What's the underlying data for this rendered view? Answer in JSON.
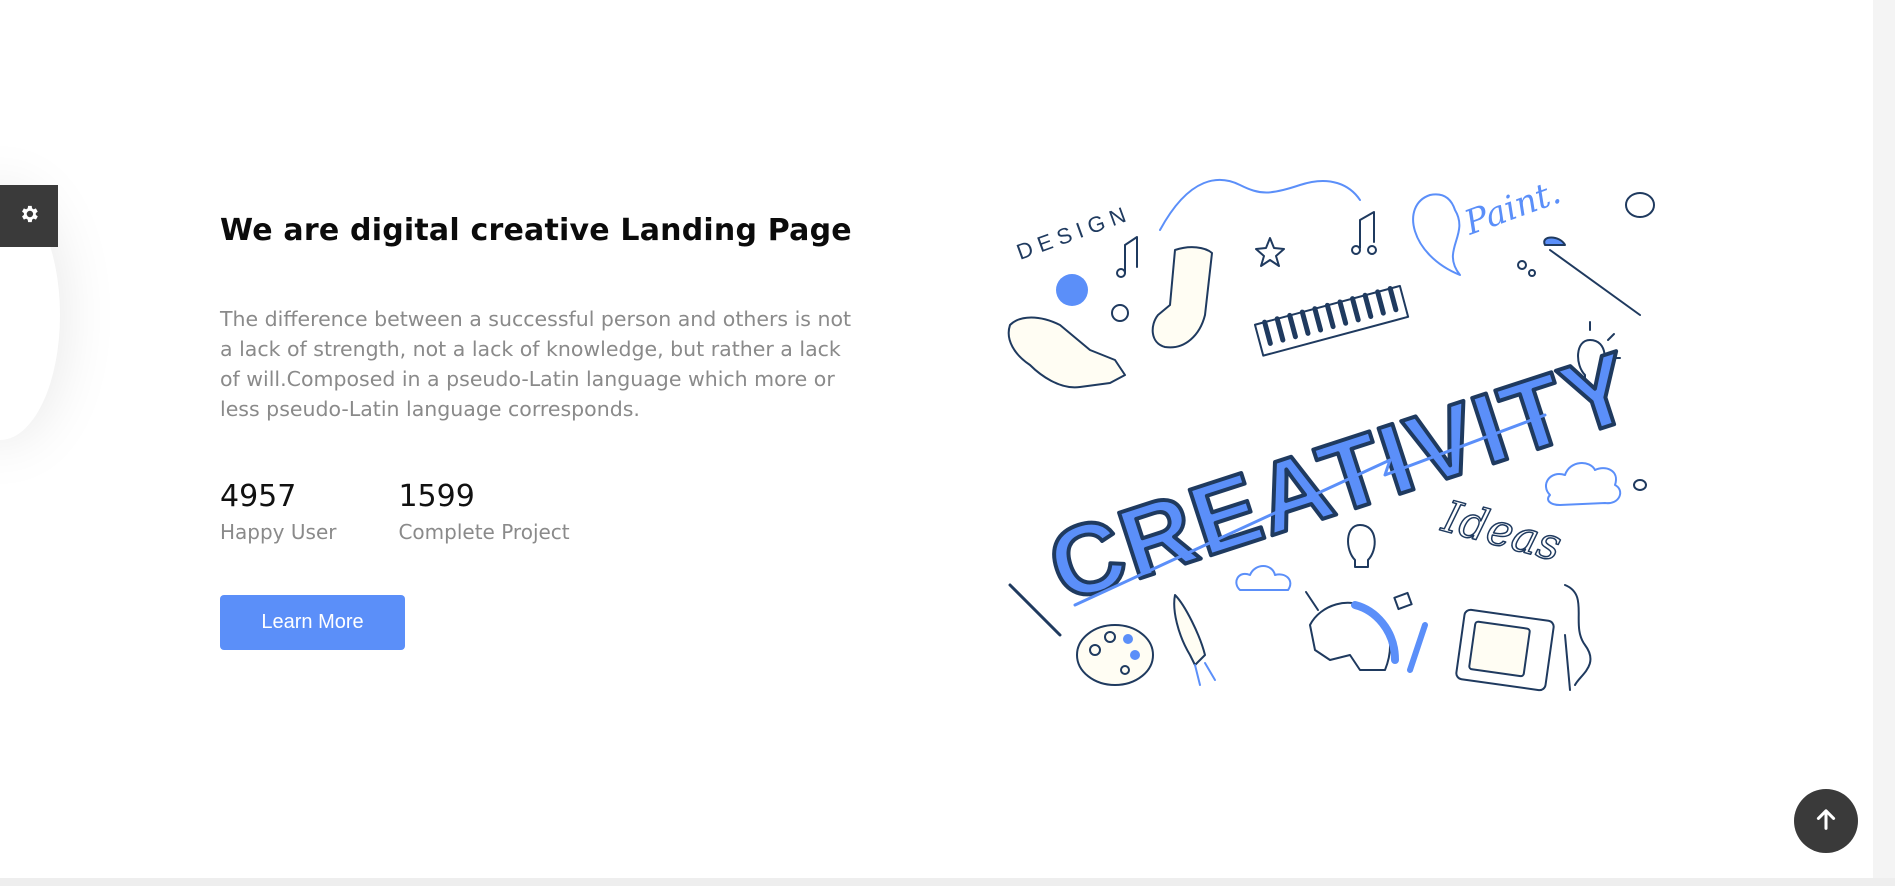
{
  "hero": {
    "title": "We are digital creative Landing Page",
    "description": "The difference between a successful person and others is not a lack of strength, not a lack of knowledge, but rather a lack of will.Composed in a pseudo-Latin language which more or less pseudo-Latin language corresponds.",
    "stats": [
      {
        "value": "4957",
        "label": "Happy User"
      },
      {
        "value": "1599",
        "label": "Complete Project"
      }
    ],
    "cta_label": "Learn More"
  },
  "illustration": {
    "word_design": "DESIGN",
    "word_creativity": "CREATIVITY",
    "word_paint": "Paint.",
    "word_ideas": "Ideas"
  },
  "icons": {
    "settings": "gear-icon",
    "scroll_top": "arrow-up-icon"
  },
  "colors": {
    "accent": "#5b8ff9",
    "dark": "#3a3a3a",
    "text_muted": "#8a8a8a",
    "ink": "#1f3a5f"
  }
}
